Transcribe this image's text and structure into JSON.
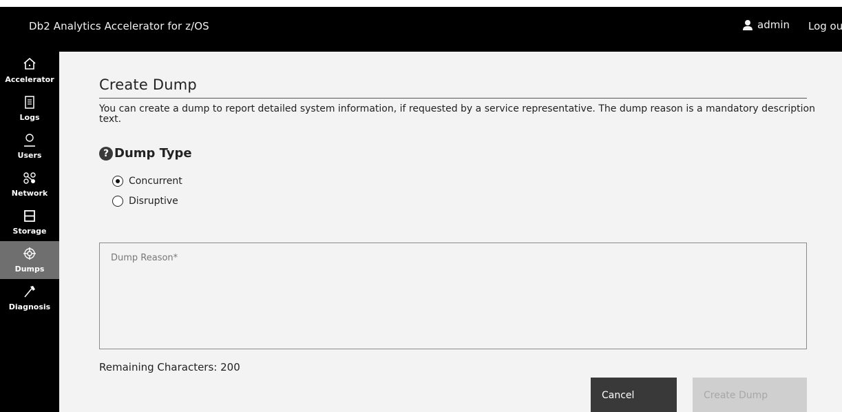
{
  "header": {
    "app_title": "Db2 Analytics Accelerator for z/OS",
    "user_name": "admin",
    "logout_label": "Log out"
  },
  "sidebar": {
    "items": [
      {
        "label": "Accelerator",
        "icon": "home-icon",
        "active": false
      },
      {
        "label": "Logs",
        "icon": "document-icon",
        "active": false
      },
      {
        "label": "Users",
        "icon": "user-icon",
        "active": false
      },
      {
        "label": "Network",
        "icon": "network-icon",
        "active": false
      },
      {
        "label": "Storage",
        "icon": "storage-icon",
        "active": false
      },
      {
        "label": "Dumps",
        "icon": "target-icon",
        "active": true
      },
      {
        "label": "Diagnosis",
        "icon": "hammer-icon",
        "active": false
      }
    ]
  },
  "main": {
    "title": "Create Dump",
    "description": "You can create a dump to report detailed system information, if requested by a service representative. The dump reason is a mandatory description text.",
    "dump_type": {
      "heading": "Dump Type",
      "help_icon": "?",
      "options": [
        {
          "label": "Concurrent",
          "checked": true
        },
        {
          "label": "Disruptive",
          "checked": false
        }
      ]
    },
    "reason": {
      "placeholder": "Dump Reason*",
      "value": ""
    },
    "remaining_text": "Remaining Characters: 200",
    "buttons": {
      "cancel_label": "Cancel",
      "create_label": "Create Dump"
    }
  },
  "colors": {
    "topbar_bg": "#000000",
    "sidebar_active_bg": "#6f6f6f",
    "content_bg": "#f3f3f3",
    "cancel_bg": "#393939",
    "create_disabled_bg": "#cfcfcf"
  }
}
